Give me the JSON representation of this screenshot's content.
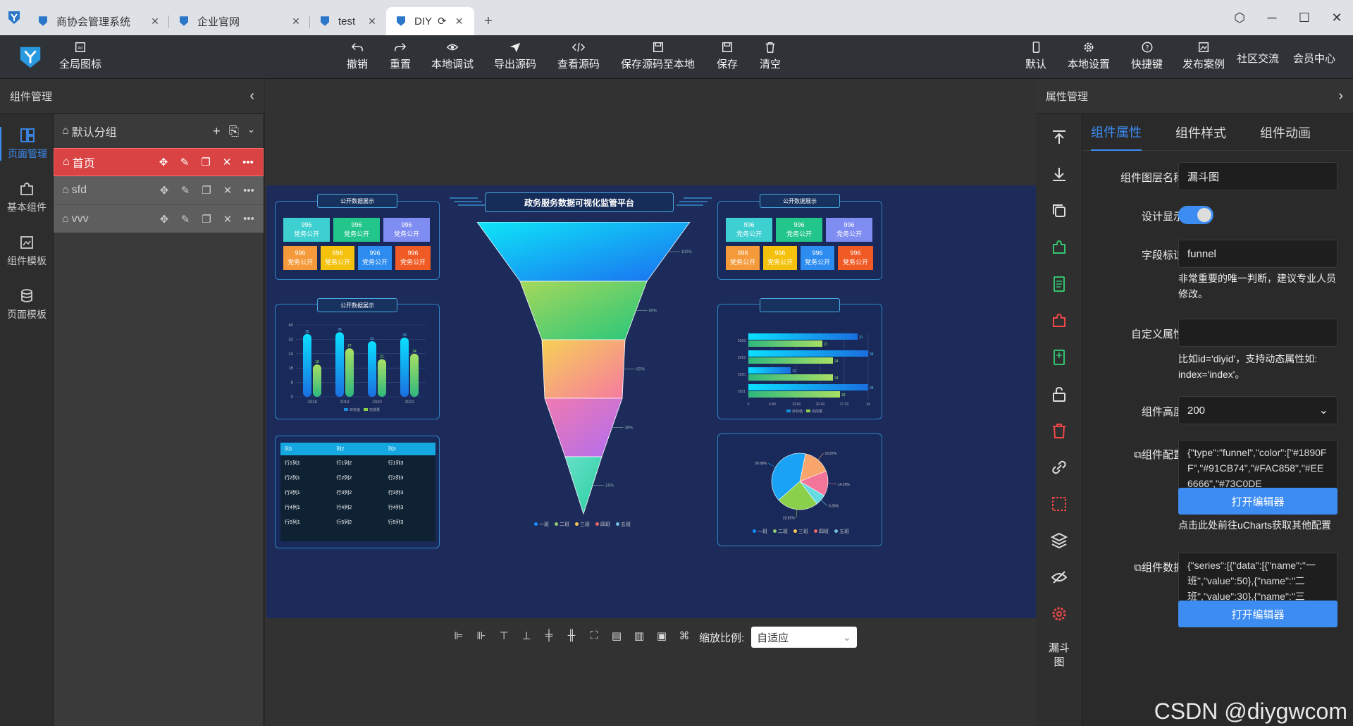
{
  "browser": {
    "tabs": [
      {
        "label": "商协会管理系统"
      },
      {
        "label": "企业官网"
      },
      {
        "label": "test"
      },
      {
        "label": "DIY"
      }
    ]
  },
  "toolbar": {
    "global_icon_label": "全局图标",
    "center_buttons": [
      "撤销",
      "重置",
      "本地调试",
      "导出源码",
      "查看源码",
      "保存源码至本地",
      "保存",
      "清空"
    ],
    "right_buttons": [
      "默认",
      "本地设置",
      "快捷键",
      "发布案例",
      "社区交流",
      "会员中心"
    ]
  },
  "left": {
    "panel_title": "组件管理",
    "rail": [
      "页面管理",
      "基本组件",
      "组件模板",
      "页面模板"
    ],
    "group_name": "默认分组",
    "pages": [
      {
        "name": "首页"
      },
      {
        "name": "sfd"
      },
      {
        "name": "vvv"
      }
    ]
  },
  "dashboard": {
    "main_title": "政务服务数据可视化监管平台",
    "panel_title": "公开数据展示",
    "tiles": [
      {
        "value": "996",
        "label": "党务公开",
        "color": "#3ecfd0"
      },
      {
        "value": "996",
        "label": "党务公开",
        "color": "#22c68a"
      },
      {
        "value": "996",
        "label": "党务公开",
        "color": "#7f8cf2"
      },
      {
        "value": "996",
        "label": "党务公开",
        "color": "#f59a3a"
      },
      {
        "value": "996",
        "label": "党务公开",
        "color": "#f4c20d"
      },
      {
        "value": "996",
        "label": "党务公开",
        "color": "#2d8cf0"
      },
      {
        "value": "996",
        "label": "党务公开",
        "color": "#f05a24"
      }
    ],
    "table": {
      "headers": [
        "列1",
        "列2",
        "列3"
      ],
      "rows": [
        [
          "行1列1",
          "行1列2",
          "行1列3"
        ],
        [
          "行2列1",
          "行2列2",
          "行2列3"
        ],
        [
          "行3列1",
          "行3列2",
          "行3列3"
        ],
        [
          "行4列1",
          "行4列2",
          "行4列3"
        ],
        [
          "行5列1",
          "行5列2",
          "行5列3"
        ]
      ]
    },
    "funnel_legend": [
      "一班",
      "二班",
      "三班",
      "四班",
      "五班"
    ],
    "funnel_labels": [
      "100%",
      "80%",
      "60%",
      "36%",
      "16%"
    ],
    "pie_labels": [
      "15.87%",
      "14.29%",
      "6.35%",
      "23.81%",
      "39.68%"
    ],
    "pie_legend": [
      "一班",
      "二班",
      "三班",
      "四班",
      "五班"
    ]
  },
  "chart_data": [
    {
      "type": "bar",
      "categories": [
        "2018",
        "2019",
        "2020",
        "2021"
      ],
      "series": [
        {
          "name": "目标值",
          "values": [
            35,
            36,
            31,
            33
          ]
        },
        {
          "name": "完成量",
          "values": [
            18,
            27,
            21,
            24
          ]
        }
      ],
      "ylim": [
        0,
        40
      ],
      "yticks": [
        "0",
        "8",
        "16",
        "24",
        "32",
        "40"
      ],
      "legend": [
        "目标值",
        "完成量"
      ]
    },
    {
      "type": "bar",
      "orientation": "horizontal",
      "categories": [
        "2018",
        "2019",
        "2020",
        "2021"
      ],
      "series": [
        {
          "name": "目标值",
          "values": [
            31,
            34,
            12,
            34
          ]
        },
        {
          "name": "完成量",
          "values": [
            21,
            24,
            24,
            26
          ]
        }
      ],
      "xticks": [
        "0",
        "6.80",
        "13.60",
        "20.40",
        "27.20",
        "34"
      ]
    },
    {
      "type": "funnel",
      "categories": [
        "一班",
        "二班",
        "三班",
        "四班",
        "五班"
      ],
      "values": [
        50,
        30,
        20,
        18,
        8
      ]
    },
    {
      "type": "pie",
      "categories": [
        "一班",
        "二班",
        "三班",
        "四班",
        "五班"
      ],
      "values": [
        15.87,
        14.29,
        6.35,
        23.81,
        39.68
      ]
    }
  ],
  "canvas": {
    "zoom_label": "缩放比例:",
    "zoom_value": "自适应"
  },
  "right": {
    "panel_title": "属性管理",
    "tabs": [
      "组件属性",
      "组件样式",
      "组件动画"
    ],
    "rail_bottom_label": "漏斗图",
    "fields": {
      "layer_name_label": "组件图层名称",
      "layer_name_value": "漏斗图",
      "design_show_label": "设计显示",
      "field_id_label": "字段标识",
      "field_id_value": "funnel",
      "field_id_hint": "非常重要的唯一判断，建议专业人员修改。",
      "custom_attr_label": "自定义属性",
      "custom_attr_value": "",
      "custom_attr_hint": "比如id='diyid'，支持动态属性如: index='index'。",
      "height_label": "组件高度",
      "height_value": "200",
      "config_label": "组件配置",
      "config_value": "{\"type\":\"funnel\",\"color\":[\"#1890FF\",\"#91CB74\",\"#FAC858\",\"#EE6666\",\"#73C0DE",
      "open_editor": "打开编辑器",
      "config_hint": "点击此处前往uCharts获取其他配置",
      "data_label": "组件数据",
      "data_value": "{\"series\":[{\"data\":[{\"name\":\"一班\",\"value\":50},{\"name\":\"二班\",\"value\":30},{\"name\":\"三"
    }
  },
  "watermark": "CSDN @diygwcom",
  "colors": {
    "accent": "#3c8cf2",
    "active_page": "#d94343",
    "dashboard_bg": "#1c2b5a"
  }
}
